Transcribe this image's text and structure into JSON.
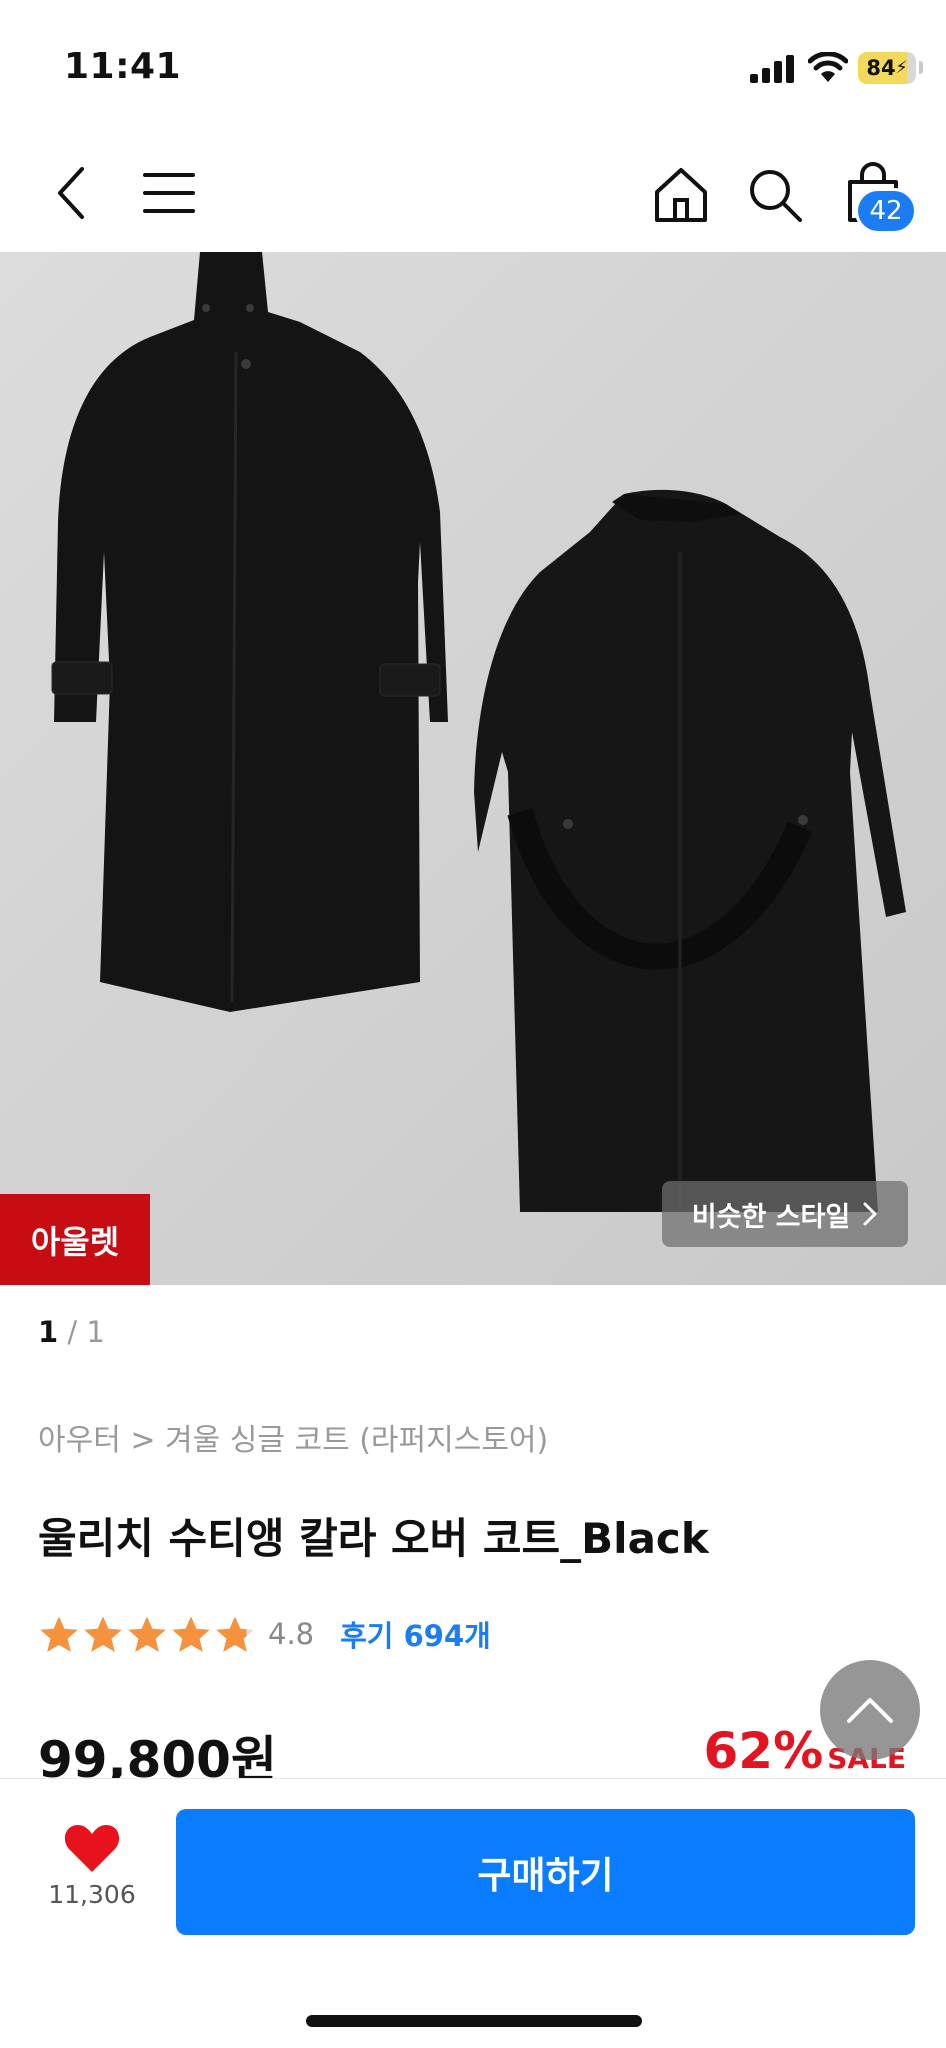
{
  "status_bar": {
    "time": "11:41",
    "battery_level": "84",
    "battery_fraction": 0.84
  },
  "nav": {
    "back_icon": "chevron-left-icon",
    "menu_icon": "hamburger-menu-icon",
    "home_icon": "home-icon",
    "search_icon": "search-icon",
    "cart_icon": "shopping-bag-icon",
    "cart_count": "42"
  },
  "gallery": {
    "outlet_badge": "아울렛",
    "similar_style_label": "비슷한 스타일",
    "current_page": "1",
    "page_separator": "/",
    "total_pages": "1"
  },
  "product": {
    "breadcrumb": "아우터 > 겨울 싱글 코트 (라퍼지스토어)",
    "title": "울리치 수티앵 칼라 오버 코트_Black",
    "rating": "4.8",
    "rating_value": 4.8,
    "reviews_label": "후기 694개",
    "price": "99,800원",
    "discount_rate": "62%",
    "discount_label": "SALE"
  },
  "bottom": {
    "like_count": "11,306",
    "buy_label": "구매하기"
  },
  "colors": {
    "accent_blue": "#0a7cff",
    "sale_red": "#e3131f",
    "outlet_red": "#c80d12",
    "star_orange": "#f5923e",
    "heart_red": "#e8121c"
  }
}
